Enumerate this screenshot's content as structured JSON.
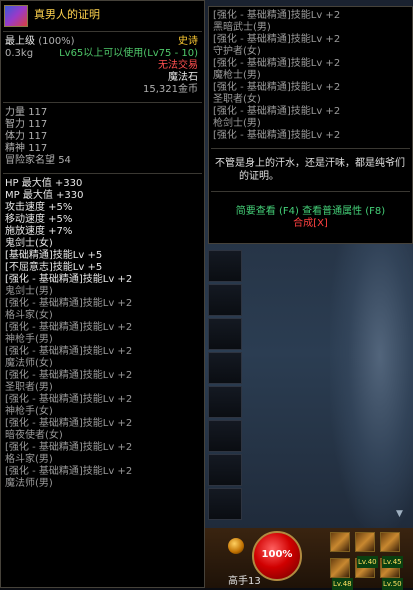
{
  "item": {
    "icon": "mage-stone-icon",
    "name": "真男人的证明",
    "level_limit": "最上级",
    "percent": "(100%)",
    "rarity": "史诗",
    "weight": "0.3kg",
    "level_req": "Lv65以上可以使用(Lv75 - 10)",
    "trade": "无法交易",
    "type": "魔法石",
    "price": "15,321金币"
  },
  "stats": [
    {
      "label": "力量",
      "value": "117"
    },
    {
      "label": "智力",
      "value": "117"
    },
    {
      "label": "体力",
      "value": "117"
    },
    {
      "label": "精神",
      "value": "117"
    },
    {
      "label": "冒险家名望",
      "value": "54"
    }
  ],
  "effects": [
    "HP 最大值 +330",
    "MP 最大值 +330",
    "攻击速度 +5%",
    "移动速度 +5%",
    "施放速度 +7%",
    "鬼剑士(女)",
    "[基础精通]技能Lv +5",
    "[不屈意志]技能Lv +5"
  ],
  "skill_bonus_left": [
    {
      "skill": "[强化 - 基础精通]技能Lv +2",
      "class": "鬼剑士(男)"
    },
    {
      "skill": "[强化 - 基础精通]技能Lv +2",
      "class": "格斗家(女)"
    },
    {
      "skill": "[强化 - 基础精通]技能Lv +2",
      "class": "神枪手(男)"
    },
    {
      "skill": "[强化 - 基础精通]技能Lv +2",
      "class": "魔法师(女)"
    },
    {
      "skill": "[强化 - 基础精通]技能Lv +2",
      "class": "圣职者(男)"
    },
    {
      "skill": "[强化 - 基础精通]技能Lv +2",
      "class": "神枪手(女)"
    },
    {
      "skill": "[强化 - 基础精通]技能Lv +2",
      "class": "暗夜使者(女)"
    },
    {
      "skill": "[强化 - 基础精通]技能Lv +2",
      "class": "格斗家(男)"
    },
    {
      "skill": "[强化 - 基础精通]技能Lv +2",
      "class": "魔法师(男)"
    }
  ],
  "skill_bonus_right": [
    {
      "skill": "[强化 - 基础精通]技能Lv +2",
      "class": "黑暗武士(男)"
    },
    {
      "skill": "[强化 - 基础精通]技能Lv +2",
      "class": "守护者(女)"
    },
    {
      "skill": "[强化 - 基础精通]技能Lv +2",
      "class": "魔枪士(男)"
    },
    {
      "skill": "[强化 - 基础精通]技能Lv +2",
      "class": "圣职者(女)"
    },
    {
      "skill": "[强化 - 基础精通]技能Lv +2",
      "class": "枪剑士(男)"
    },
    {
      "skill": "[强化 - 基础精通]技能Lv +2",
      "class": ""
    }
  ],
  "description": "不管是身上的汗水，还是汗味，都是纯爷们的证明。",
  "buttons": {
    "brief": "简要查看 (F4)",
    "normal": "查看普通属性 (F8)",
    "compose": "合成[X]"
  },
  "hud": {
    "hp_percent": "100%",
    "char_label": "高手13",
    "skill_levels": [
      "Lv.40",
      "Lv.45",
      "Lv.48",
      "Lv.50"
    ]
  },
  "colors": {
    "epic": "#ffcc33",
    "skill_bonus": "#b0b0b0",
    "untradeable": "#ff5050",
    "button": "#44d078"
  }
}
